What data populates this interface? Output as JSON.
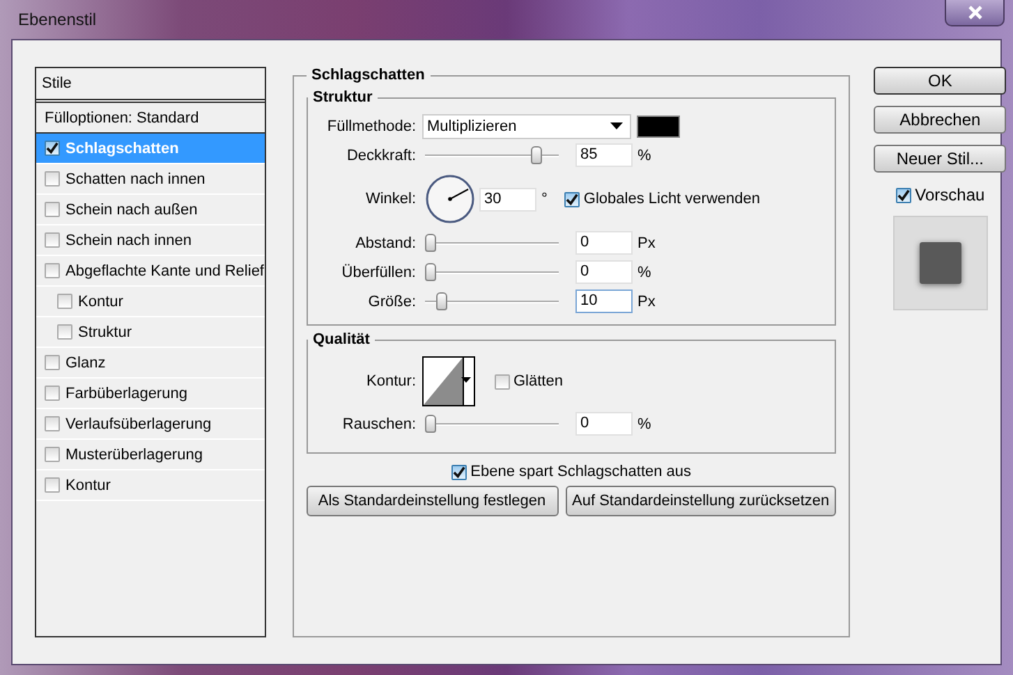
{
  "window": {
    "title": "Ebenenstil"
  },
  "styles": {
    "header": "Stile",
    "items": [
      {
        "kind": "plain",
        "label": "Fülloptionen: Standard",
        "selected": false
      },
      {
        "kind": "checkbox",
        "label": "Schlagschatten",
        "checked": true,
        "selected": true
      },
      {
        "kind": "checkbox",
        "label": "Schatten nach innen",
        "checked": false,
        "selected": false
      },
      {
        "kind": "checkbox",
        "label": "Schein nach außen",
        "checked": false,
        "selected": false
      },
      {
        "kind": "checkbox",
        "label": "Schein nach innen",
        "checked": false,
        "selected": false
      },
      {
        "kind": "checkbox",
        "label": "Abgeflachte Kante und Relief",
        "checked": false,
        "selected": false,
        "children": [
          {
            "kind": "checkbox",
            "label": "Kontur",
            "checked": false,
            "selected": false
          },
          {
            "kind": "checkbox",
            "label": "Struktur",
            "checked": false,
            "selected": false
          }
        ]
      },
      {
        "kind": "checkbox",
        "label": "Glanz",
        "checked": false,
        "selected": false
      },
      {
        "kind": "checkbox",
        "label": "Farbüberlagerung",
        "checked": false,
        "selected": false
      },
      {
        "kind": "checkbox",
        "label": "Verlaufsüberlagerung",
        "checked": false,
        "selected": false
      },
      {
        "kind": "checkbox",
        "label": "Musterüberlagerung",
        "checked": false,
        "selected": false
      },
      {
        "kind": "checkbox",
        "label": "Kontur",
        "checked": false,
        "selected": false
      }
    ]
  },
  "section": {
    "title": "Schlagschatten",
    "structure": {
      "title": "Struktur",
      "blend_mode": {
        "label": "Füllmethode:",
        "value": "Multiplizieren",
        "color": "#000000"
      },
      "opacity": {
        "label": "Deckkraft:",
        "level": 0.87,
        "value": "85",
        "unit": "%"
      },
      "angle": {
        "label": "Winkel:",
        "value": "30",
        "unit": "°",
        "global_light": {
          "label": "Globales Licht verwenden",
          "checked": true
        }
      },
      "sliders": [
        {
          "label": "Abstand:",
          "level": 0,
          "value": "0",
          "unit": "Px",
          "focused": false
        },
        {
          "label": "Überfüllen:",
          "level": 0,
          "value": "0",
          "unit": "%",
          "focused": false
        },
        {
          "label": "Größe:",
          "level": 0.1,
          "value": "10",
          "unit": "Px",
          "focused": true
        }
      ]
    },
    "quality": {
      "title": "Qualität",
      "contour": {
        "label": "Kontur:",
        "antialias": {
          "label": "Glätten",
          "checked": false
        }
      },
      "noise": {
        "label": "Rauschen:",
        "level": 0,
        "value": "0",
        "unit": "%"
      }
    },
    "knockout": {
      "label": "Ebene spart Schlagschatten aus",
      "checked": true
    },
    "buttons": [
      "Als Standardeinstellung festlegen",
      "Auf Standardeinstellung zurücksetzen"
    ]
  },
  "actions": [
    "OK",
    "Abbrechen",
    "Neuer Stil..."
  ],
  "preview": {
    "label": "Vorschau",
    "checked": true
  }
}
